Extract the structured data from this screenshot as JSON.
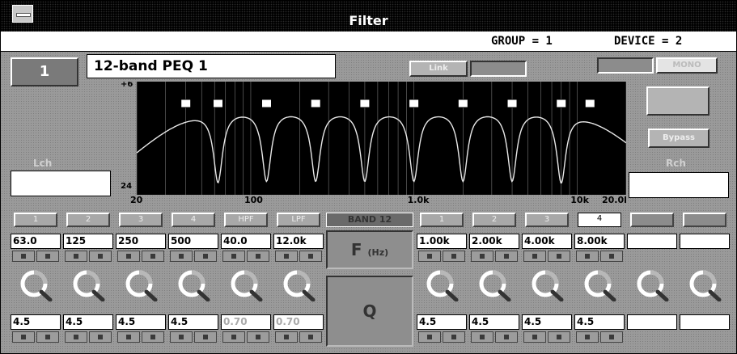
{
  "window": {
    "title": "Filter"
  },
  "status": {
    "group": "GROUP  =  1",
    "device": "DEVICE  =  2"
  },
  "channel": {
    "number": "1",
    "preset_name": "12-band PEQ 1"
  },
  "top_buttons": {
    "link": "Link",
    "mono": "MONO"
  },
  "side": {
    "left_label": "Lch",
    "right_label": "Rch",
    "bypass": "Bypass"
  },
  "graph": {
    "y_top": "+6",
    "y_bottom": "-24",
    "x_ticks": [
      "20",
      "100",
      "1.0k",
      "10k",
      "20.0k"
    ],
    "markers": [
      "1",
      "2",
      "3",
      "4",
      "5",
      "6",
      "7",
      "8",
      "9",
      "10",
      "11",
      "12"
    ]
  },
  "center": {
    "freq": "F",
    "freq_unit": "(Hz)",
    "q": "Q",
    "band_label": "BAND 12"
  },
  "bands_left": [
    {
      "label": "1",
      "freq": "63.0",
      "q": "4.5"
    },
    {
      "label": "2",
      "freq": "125",
      "q": "4.5"
    },
    {
      "label": "3",
      "freq": "250",
      "q": "4.5"
    },
    {
      "label": "4",
      "freq": "500",
      "q": "4.5"
    },
    {
      "label": "HPF",
      "freq": "40.0",
      "q": "0.70"
    },
    {
      "label": "LPF",
      "freq": "12.0k",
      "q": "0.70"
    }
  ],
  "bands_right": [
    {
      "label": "1",
      "freq": "1.00k",
      "q": "4.5"
    },
    {
      "label": "2",
      "freq": "2.00k",
      "q": "4.5"
    },
    {
      "label": "3",
      "freq": "4.00k",
      "q": "4.5"
    },
    {
      "label": "4",
      "freq": "8.00k",
      "q": "4.5"
    },
    {
      "label": "",
      "freq": "",
      "q": ""
    },
    {
      "label": "",
      "freq": "",
      "q": ""
    }
  ]
}
